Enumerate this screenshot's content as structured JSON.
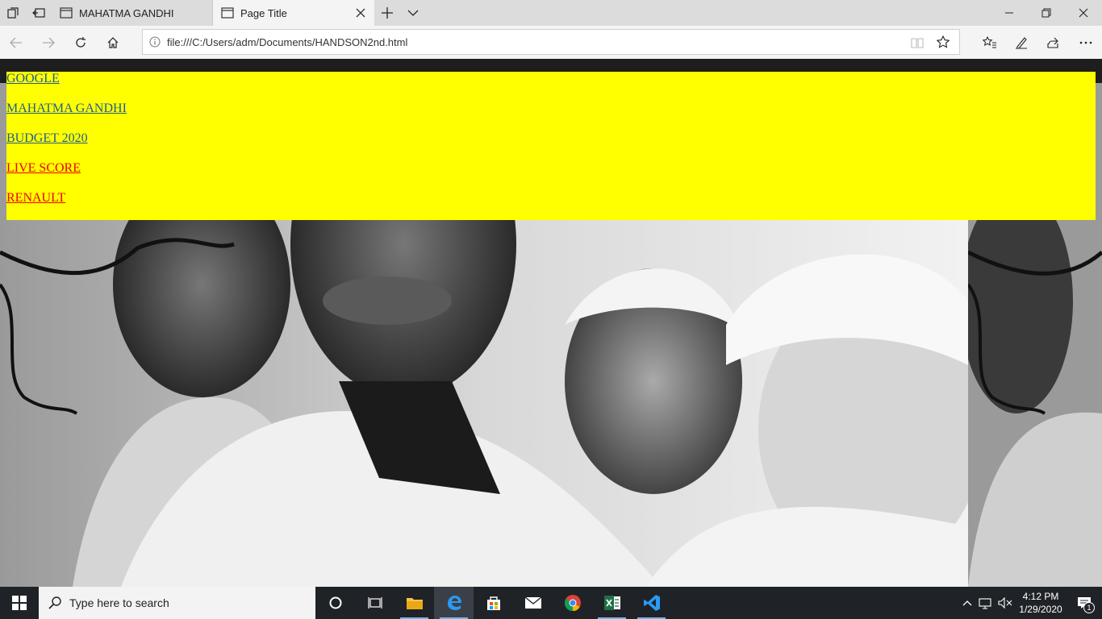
{
  "browser": {
    "tabs": [
      {
        "label": "MAHATMA GANDHI"
      },
      {
        "label": "Page Title"
      }
    ],
    "address_url": "file:///C:/Users/adm/Documents/HANDSON2nd.html"
  },
  "page": {
    "links": [
      {
        "label": "GOOGLE",
        "state": "visited"
      },
      {
        "label": "MAHATMA GANDHI",
        "state": "visited"
      },
      {
        "label": "BUDGET 2020",
        "state": "visited"
      },
      {
        "label": "LIVE SCORE",
        "state": "unvisited"
      },
      {
        "label": "RENAULT",
        "state": "unvisited"
      }
    ],
    "menu_background": "#ffff00",
    "visited_color": "#1f5f8b",
    "unvisited_color": "#ee0000"
  },
  "taskbar": {
    "search_placeholder": "Type here to search",
    "apps": [
      "task-view-icon",
      "file-explorer-icon",
      "edge-icon",
      "store-icon",
      "mail-icon",
      "chrome-icon",
      "excel-icon",
      "vscode-icon"
    ],
    "time": "4:12 PM",
    "date": "1/29/2020",
    "notification_count": "1"
  }
}
